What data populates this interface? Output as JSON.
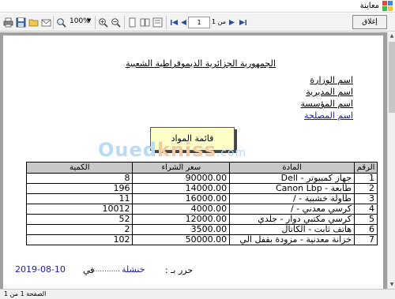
{
  "window": {
    "title": "معاينة"
  },
  "toolbar": {
    "zoom": "100%",
    "page_current": "1",
    "page_total_label": "من 1",
    "close_label": "إغلاق"
  },
  "report": {
    "republic": "الجمهورية الجزائرية الديموقراطية الشعبية",
    "ministry": "اسم الوزارة",
    "directorate": "اسم المديرية",
    "institution": "اسم المؤسسة",
    "department": "اسم المصلحة",
    "list_title": "قائمة المواد",
    "watermark": {
      "part1": "Oued",
      "part2": "kniss",
      "part3": ".com"
    },
    "table": {
      "headers": {
        "num": "الرقم",
        "item": "المادة",
        "price": "سعر الشراء",
        "qty": "الكمية"
      },
      "rows": [
        {
          "num": "1",
          "item": "جهاز كمبيوتر - Dell",
          "price": "90000.00",
          "qty": "8"
        },
        {
          "num": "2",
          "item": "طابعة - Canon Lbp",
          "price": "14000.00",
          "qty": "196"
        },
        {
          "num": "3",
          "item": "طاولة خشبية - /",
          "price": "16000.00",
          "qty": "11"
        },
        {
          "num": "4",
          "item": "كرسي معدني - /",
          "price": "4000.00",
          "qty": "10012"
        },
        {
          "num": "5",
          "item": "كرسي مكتبي دوار - جلدي",
          "price": "12000.00",
          "qty": "52"
        },
        {
          "num": "6",
          "item": "هاتف ثابت - الكاتال",
          "price": "3500.00",
          "qty": "2"
        },
        {
          "num": "7",
          "item": "خزانة معدنية - مزودة بقفل الي",
          "price": "50000.00",
          "qty": "102"
        }
      ]
    },
    "signature": {
      "label": "حرر بـ :",
      "place": "خنشلة",
      "dots": "..............",
      "in_label": "في",
      "date": "2019-08-10"
    }
  },
  "status": {
    "text": "الصفحة 1 من 1"
  },
  "colors": {
    "link_blue": "#1a1ab0",
    "header_gray": "#c8c8c8",
    "title_box": "#ffffc8"
  }
}
